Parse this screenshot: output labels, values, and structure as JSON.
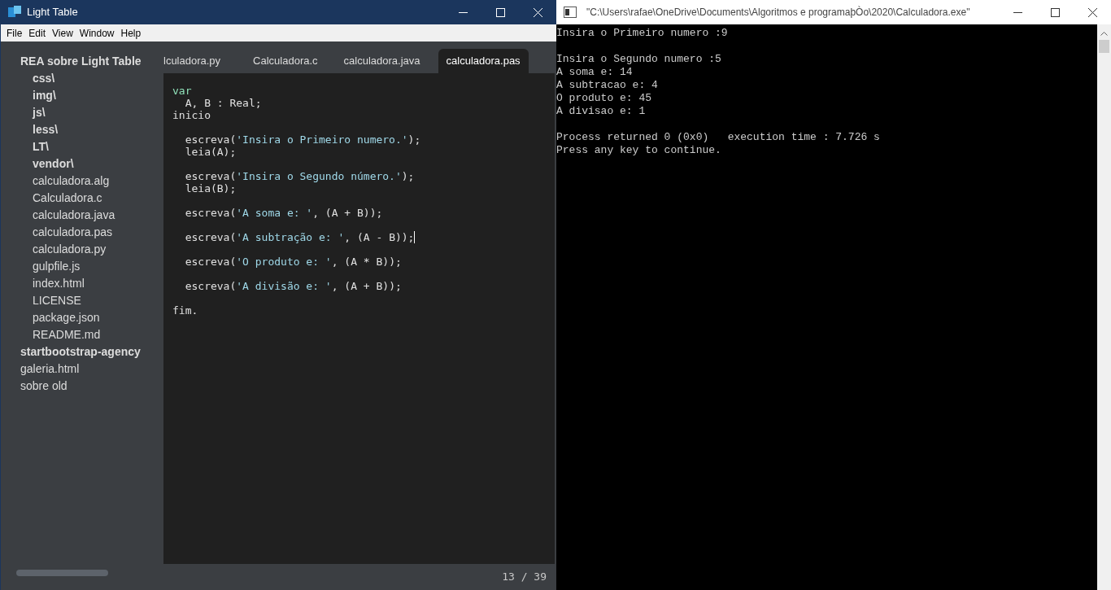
{
  "editor_window": {
    "title": "Light Table",
    "menu": [
      "File",
      "Edit",
      "View",
      "Window",
      "Help"
    ],
    "sidebar": {
      "items": [
        {
          "label": "REA sobre Light Table",
          "kind": "folder",
          "children": [
            {
              "label": "css\\",
              "kind": "folder"
            },
            {
              "label": "img\\",
              "kind": "folder"
            },
            {
              "label": "js\\",
              "kind": "folder"
            },
            {
              "label": "less\\",
              "kind": "folder"
            },
            {
              "label": "LT\\",
              "kind": "folder"
            },
            {
              "label": "vendor\\",
              "kind": "folder"
            },
            {
              "label": "calculadora.alg",
              "kind": "file"
            },
            {
              "label": "Calculadora.c",
              "kind": "file"
            },
            {
              "label": "calculadora.java",
              "kind": "file"
            },
            {
              "label": "calculadora.pas",
              "kind": "file"
            },
            {
              "label": "calculadora.py",
              "kind": "file"
            },
            {
              "label": "gulpfile.js",
              "kind": "file"
            },
            {
              "label": "index.html",
              "kind": "file"
            },
            {
              "label": "LICENSE",
              "kind": "file"
            },
            {
              "label": "package.json",
              "kind": "file"
            },
            {
              "label": "README.md",
              "kind": "file"
            }
          ]
        },
        {
          "label": "startbootstrap-agency",
          "kind": "folder"
        },
        {
          "label": "galeria.html",
          "kind": "file"
        },
        {
          "label": "sobre old",
          "kind": "file"
        }
      ]
    },
    "tabs": [
      {
        "label": "lculadora.py",
        "selected": false
      },
      {
        "label": "Calculadora.c",
        "selected": false
      },
      {
        "label": "calculadora.java",
        "selected": false
      },
      {
        "label": "calculadora.pas",
        "selected": true
      }
    ],
    "code_lines": [
      {
        "kind": "code",
        "cursor": false,
        "segments": [
          {
            "kind": "keyword",
            "text": "var"
          }
        ]
      },
      {
        "kind": "code",
        "cursor": false,
        "segments": [
          {
            "kind": "plain",
            "text": "  A, B : Real;"
          }
        ]
      },
      {
        "kind": "code",
        "cursor": false,
        "segments": [
          {
            "kind": "plain",
            "text": "inicio"
          }
        ]
      },
      {
        "kind": "blank"
      },
      {
        "kind": "code",
        "cursor": false,
        "segments": [
          {
            "kind": "plain",
            "text": "  escreva("
          },
          {
            "kind": "string",
            "text": "'Insira o Primeiro numero.'"
          },
          {
            "kind": "plain",
            "text": ");"
          }
        ]
      },
      {
        "kind": "code",
        "cursor": false,
        "segments": [
          {
            "kind": "plain",
            "text": "  leia(A);"
          }
        ]
      },
      {
        "kind": "blank"
      },
      {
        "kind": "code",
        "cursor": false,
        "segments": [
          {
            "kind": "plain",
            "text": "  escreva("
          },
          {
            "kind": "string",
            "text": "'Insira o Segundo número.'"
          },
          {
            "kind": "plain",
            "text": ");"
          }
        ]
      },
      {
        "kind": "code",
        "cursor": false,
        "segments": [
          {
            "kind": "plain",
            "text": "  leia(B);"
          }
        ]
      },
      {
        "kind": "blank"
      },
      {
        "kind": "code",
        "cursor": false,
        "segments": [
          {
            "kind": "plain",
            "text": "  escreva("
          },
          {
            "kind": "string",
            "text": "'A soma e: '"
          },
          {
            "kind": "plain",
            "text": ", (A + B));"
          }
        ]
      },
      {
        "kind": "blank"
      },
      {
        "kind": "code",
        "cursor": true,
        "segments": [
          {
            "kind": "plain",
            "text": "  escreva("
          },
          {
            "kind": "string",
            "text": "'A subtração e: '"
          },
          {
            "kind": "plain",
            "text": ", (A - B));"
          }
        ]
      },
      {
        "kind": "blank"
      },
      {
        "kind": "code",
        "cursor": false,
        "segments": [
          {
            "kind": "plain",
            "text": "  escreva("
          },
          {
            "kind": "string",
            "text": "'O produto e: '"
          },
          {
            "kind": "plain",
            "text": ", (A * B));"
          }
        ]
      },
      {
        "kind": "blank"
      },
      {
        "kind": "code",
        "cursor": false,
        "segments": [
          {
            "kind": "plain",
            "text": "  escreva("
          },
          {
            "kind": "string",
            "text": "'A divisão e: '"
          },
          {
            "kind": "plain",
            "text": ", (A + B));"
          }
        ]
      },
      {
        "kind": "blank"
      },
      {
        "kind": "code",
        "cursor": false,
        "segments": [
          {
            "kind": "plain",
            "text": "fim."
          }
        ]
      }
    ],
    "status": "13 / 39"
  },
  "console_window": {
    "title": "\"C:\\Users\\rafae\\OneDrive\\Documents\\Algoritmos e programaþÒo\\2020\\Calculadora.exe\"",
    "lines": [
      {
        "kind": "text",
        "text": "Insira o Primeiro numero :9"
      },
      {
        "kind": "blank"
      },
      {
        "kind": "text",
        "text": "Insira o Segundo numero :5"
      },
      {
        "kind": "text",
        "text": "A soma e: 14"
      },
      {
        "kind": "text",
        "text": "A subtracao e: 4"
      },
      {
        "kind": "text",
        "text": "O produto e: 45"
      },
      {
        "kind": "text",
        "text": "A divisao e: 1"
      },
      {
        "kind": "blank"
      },
      {
        "kind": "text",
        "text": "Process returned 0 (0x0)   execution time : 7.726 s"
      },
      {
        "kind": "text",
        "text": "Press any key to continue."
      }
    ]
  }
}
